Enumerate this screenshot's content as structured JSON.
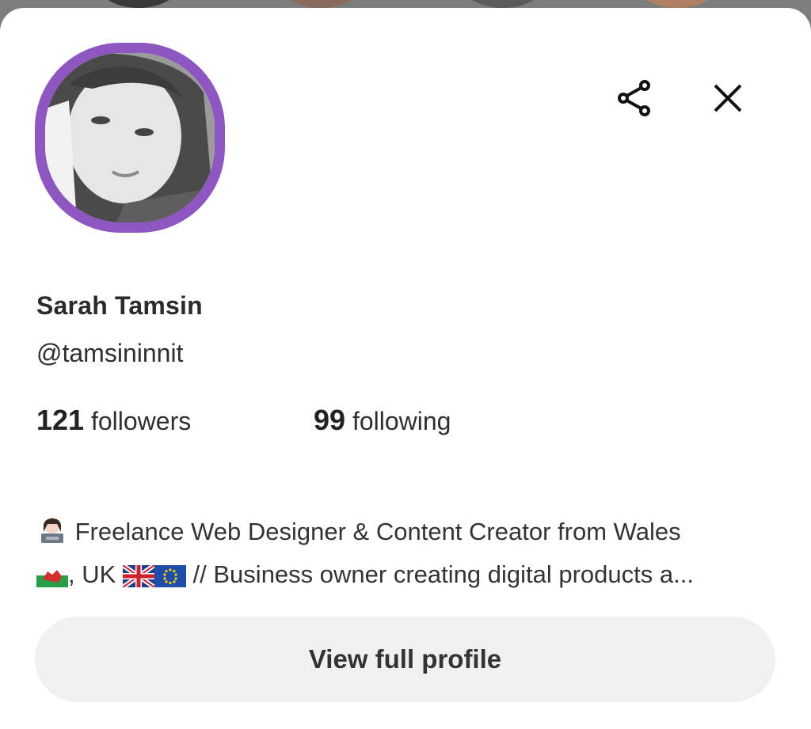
{
  "profile": {
    "name": "Sarah Tamsin",
    "handle": "@tamsininnit",
    "followers_count": "121",
    "followers_label": "followers",
    "following_count": "99",
    "following_label": "following",
    "bio_line1": "Freelance Web Designer & Content Creator from Wales",
    "bio_line2_a": ", UK",
    "bio_line2_b": "// Business owner creating digital products a...",
    "avatar_ring_color": "#8e56c1"
  },
  "actions": {
    "share_icon": "share-icon",
    "close_icon": "close-icon",
    "view_full_profile": "View full profile"
  },
  "bio_emojis": [
    "woman-technologist-emoji",
    "wales-flag-emoji",
    "uk-flag-emoji",
    "eu-flag-emoji"
  ]
}
